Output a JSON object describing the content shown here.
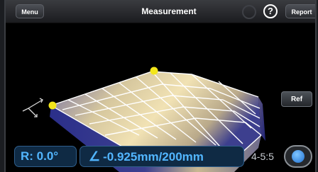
{
  "navbar": {
    "menu_label": "Menu",
    "title": "Measurement",
    "help_label": "?",
    "report_label": "Report"
  },
  "viewport": {
    "ref_label": "Ref"
  },
  "status": {
    "rotation": "R: 0.0°",
    "angle_symbol": "∠",
    "angle_value": "-0.925mm/200mm",
    "ratio": "4-5:5"
  },
  "colors": {
    "readout_text": "#52b6ff",
    "readout_bg": "#0f2a44",
    "marker": "#f3e61a",
    "surface_warm": "#f1e2b4",
    "surface_deep": "#2b2f8a"
  }
}
